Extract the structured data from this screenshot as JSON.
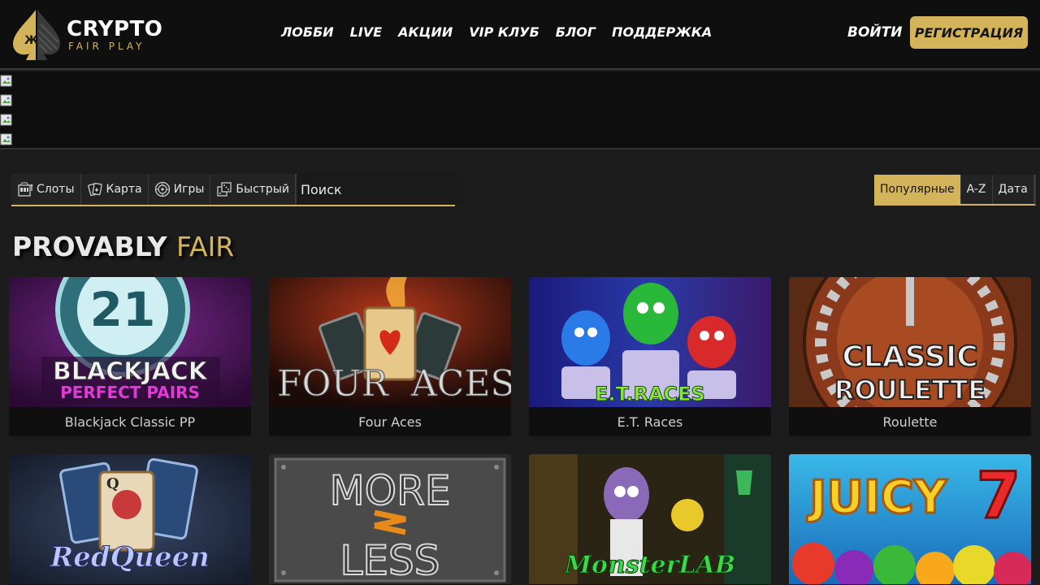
{
  "header": {
    "logo_name": "CRYPTO",
    "logo_sub": "FAIR PLAY",
    "nav": [
      {
        "label": "ЛОББИ"
      },
      {
        "label": "LIVE"
      },
      {
        "label": "АКЦИИ"
      },
      {
        "label": "VIP КЛУБ"
      },
      {
        "label": "БЛОГ"
      },
      {
        "label": "ПОДДЕРЖКА"
      }
    ],
    "login_label": "ВОЙТИ",
    "register_label": "РЕГИСТРАЦИЯ"
  },
  "filters": {
    "tabs": [
      {
        "label": "Слоты",
        "icon": "slot-machine-icon"
      },
      {
        "label": "Карта",
        "icon": "cards-icon"
      },
      {
        "label": "Игры",
        "icon": "roulette-wheel-icon"
      },
      {
        "label": "Быстрый",
        "icon": "instant-game-icon"
      }
    ],
    "search_placeholder": "Поиск"
  },
  "sort": {
    "options": [
      {
        "label": "Популярные",
        "active": true
      },
      {
        "label": "A-Z",
        "active": false
      },
      {
        "label": "Дата",
        "active": false
      }
    ]
  },
  "section": {
    "title_bold": "PROVABLY",
    "title_light": "FAIR"
  },
  "games": [
    {
      "name": "Blackjack Classic PP",
      "art_text": [
        "21",
        "BLACKJACK",
        "PERFECT PAIRS"
      ]
    },
    {
      "name": "Four Aces",
      "art_text": [
        "FOUR",
        "ACES"
      ]
    },
    {
      "name": "E.T. Races",
      "art_text": [
        "E.T.RACES"
      ]
    },
    {
      "name": "Roulette",
      "art_text": [
        "CLASSIC",
        "ROULETTE"
      ]
    },
    {
      "name": "Red Queen",
      "art_text": [
        "RedQueen"
      ]
    },
    {
      "name": "More Less",
      "art_text": [
        "MORE",
        "LESS"
      ]
    },
    {
      "name": "Monster Lab",
      "art_text": [
        "MonsterLAB"
      ]
    },
    {
      "name": "Juicy 7",
      "art_text": [
        "JUICY",
        "7"
      ]
    }
  ],
  "colors": {
    "accent": "#d4b45a",
    "header_bg": "#0f0f0f",
    "page_bg": "#1c1c1c"
  }
}
